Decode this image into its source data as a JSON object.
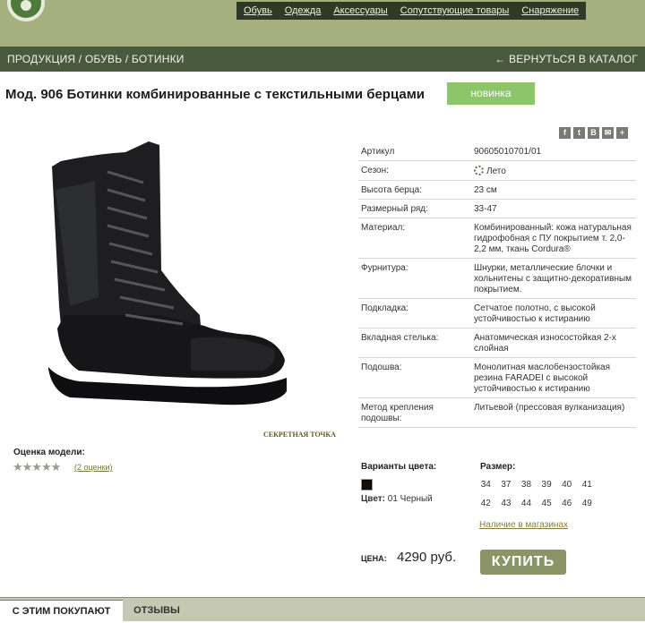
{
  "nav": {
    "items": [
      "Обувь",
      "Одежда",
      "Аксессуары",
      "Сопутствующие товары",
      "Снаряжение"
    ]
  },
  "breadcrumb": {
    "text": "ПРОДУКЦИЯ / ОБУВЬ / БОТИНКИ",
    "back": "← ВЕРНУТЬСЯ В КАТАЛОГ"
  },
  "product": {
    "title": "Мод. 906 Ботинки комбинированные с текстильными берцами",
    "badge": "новинка",
    "watermark": "СЕКРЕТНАЯ ТОЧКА"
  },
  "social": {
    "icons": [
      "f",
      "t",
      "B",
      "✉",
      "+"
    ]
  },
  "rating": {
    "label": "Оценка модели:",
    "stars": "★★★★★",
    "reviews": "(2 оценки)"
  },
  "specs": [
    {
      "key": "Артикул",
      "value": "90605010701/01"
    },
    {
      "key": "Сезон:",
      "value": "Лето"
    },
    {
      "key": "Высота берца:",
      "value": "23 см"
    },
    {
      "key": "Размерный ряд:",
      "value": "33-47"
    },
    {
      "key": "Материал:",
      "value": "Комбинированный: кожа натуральная гидрофобная с ПУ покрытием т. 2,0-2,2 мм, ткань Cordura®"
    },
    {
      "key": "Фурнитура:",
      "value": "Шнурки, металлические блочки и хольнитены с защитно-декоративным покрытием."
    },
    {
      "key": "Подкладка:",
      "value": "Сетчатое полотно, с высокой устойчивостью к истиранию"
    },
    {
      "key": "Вкладная стелька:",
      "value": "Анатомическая износостойкая 2-х слойная"
    },
    {
      "key": "Подошва:",
      "value": "Монолитная маслобензостойкая резина FARADEI с высокой устойчивостью к истиранию"
    },
    {
      "key": "Метод крепления подошвы:",
      "value": "Литьевой (прессовая вулканизация)"
    }
  ],
  "color": {
    "label": "Варианты цвета:",
    "name_label": "Цвет:",
    "name": "01 Черный",
    "swatch": "#1a0c08"
  },
  "sizes": {
    "label": "Размер:",
    "values": [
      "34",
      "37",
      "38",
      "39",
      "40",
      "41",
      "42",
      "43",
      "44",
      "45",
      "46",
      "49"
    ],
    "stores_link": "Наличие в магазинах"
  },
  "price": {
    "label": "ЦЕНА:",
    "value": "4290 руб.",
    "buy": "КУПИТЬ"
  },
  "tabs": [
    "С ЭТИМ ПОКУПАЮТ",
    "ОТЗЫВЫ"
  ],
  "colors": {
    "top_bar": "#a6b07f",
    "breadcrumb_bar": "#4a5a3e",
    "badge": "#8cc56a",
    "buy_button": "#8a9466"
  }
}
